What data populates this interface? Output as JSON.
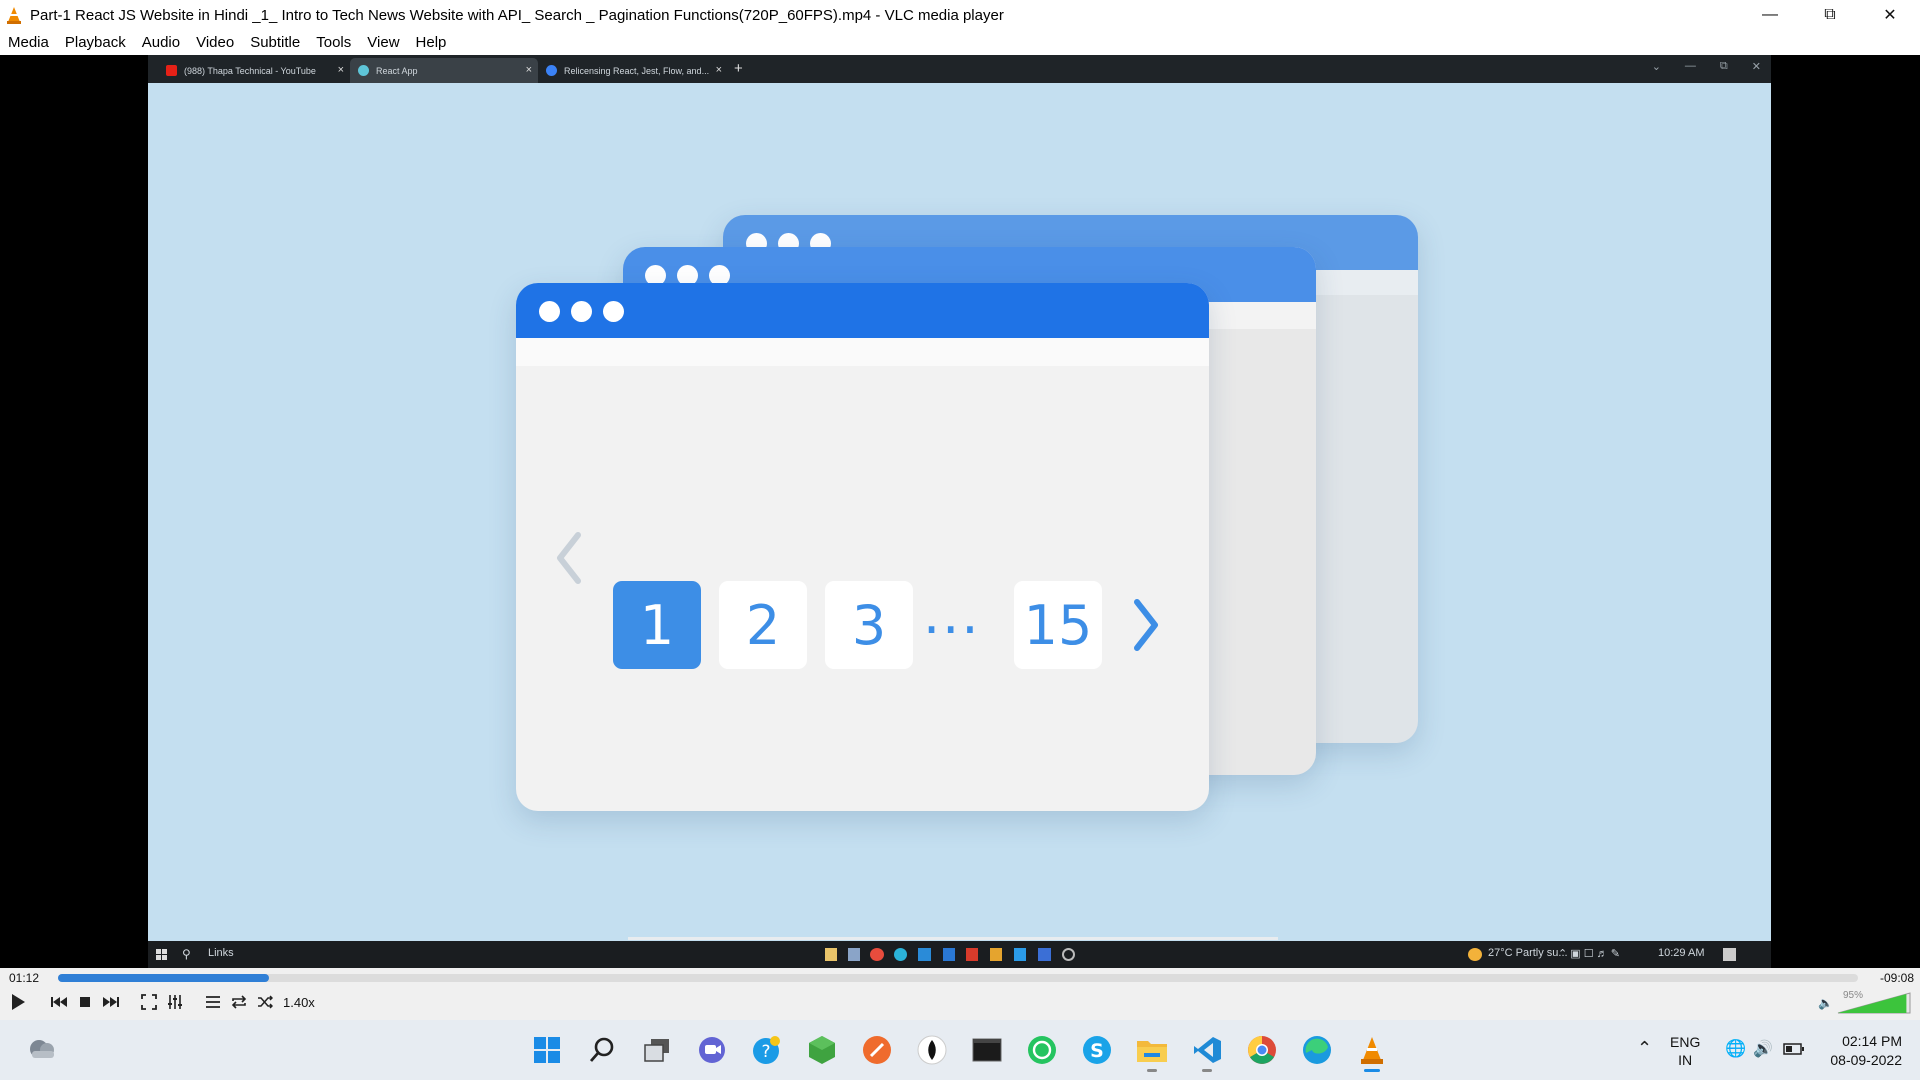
{
  "window": {
    "title": "Part-1  React JS Website in Hindi _1_ Intro to Tech News Website with API_ Search _ Pagination Functions(720P_60FPS).mp4 - VLC media player"
  },
  "menu": [
    "Media",
    "Playback",
    "Audio",
    "Video",
    "Subtitle",
    "Tools",
    "View",
    "Help"
  ],
  "inner_browser": {
    "tabs": [
      {
        "label": "(988) Thapa Technical - YouTube",
        "favicon_color": "#e62117"
      },
      {
        "label": "React App",
        "favicon_color": "#5ec5d8"
      },
      {
        "label": "Relicensing React, Jest, Flow, and...",
        "favicon_color": "#3b82f6"
      }
    ]
  },
  "pagination": {
    "pages": [
      "1",
      "2",
      "3",
      "15"
    ],
    "ellipsis": "...",
    "active": "1"
  },
  "inner_taskbar": {
    "search_label": "Links",
    "weather": "27°C  Partly su...",
    "clock": "10:29 AM"
  },
  "player": {
    "elapsed": "01:12",
    "remaining": "-09:08",
    "progress": 0.117,
    "speed": "1.40x",
    "volume_label": "95%",
    "volume": 0.95
  },
  "taskbar": {
    "lang_line1": "ENG",
    "lang_line2": "IN",
    "time": "02:14 PM",
    "date": "08-09-2022"
  },
  "colors": {
    "video_bg": "#c4dff0",
    "accent": "#3d8ee6",
    "vlc_orange": "#f08a00"
  }
}
